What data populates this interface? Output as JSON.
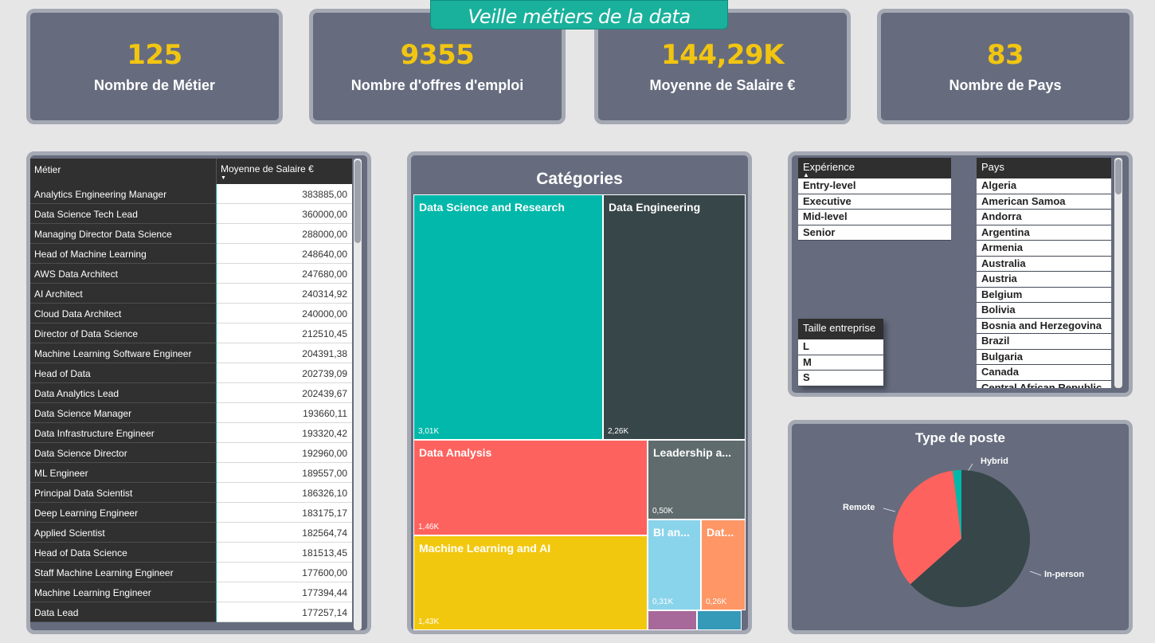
{
  "banner_title": "Veille métiers de la data",
  "kpis": [
    {
      "value": "125",
      "label": "Nombre de Métier"
    },
    {
      "value": "9355",
      "label": "Nombre d'offres d'emploi"
    },
    {
      "value": "144,29K",
      "label": "Moyenne de Salaire €"
    },
    {
      "value": "83",
      "label": "Nombre de Pays"
    }
  ],
  "table": {
    "col1": "Métier",
    "col2": "Moyenne de Salaire €",
    "rows": [
      {
        "name": "Analytics Engineering Manager",
        "value": "383885,00"
      },
      {
        "name": "Data Science Tech Lead",
        "value": "360000,00"
      },
      {
        "name": "Managing Director Data Science",
        "value": "288000,00"
      },
      {
        "name": "Head of Machine Learning",
        "value": "248640,00"
      },
      {
        "name": "AWS Data Architect",
        "value": "247680,00"
      },
      {
        "name": "AI Architect",
        "value": "240314,92"
      },
      {
        "name": "Cloud Data Architect",
        "value": "240000,00"
      },
      {
        "name": "Director of Data Science",
        "value": "212510,45"
      },
      {
        "name": "Machine Learning Software Engineer",
        "value": "204391,38"
      },
      {
        "name": "Head of Data",
        "value": "202739,09"
      },
      {
        "name": "Data Analytics Lead",
        "value": "202439,67"
      },
      {
        "name": "Data Science Manager",
        "value": "193660,11"
      },
      {
        "name": "Data Infrastructure Engineer",
        "value": "193320,42"
      },
      {
        "name": "Data Science Director",
        "value": "192960,00"
      },
      {
        "name": "ML Engineer",
        "value": "189557,00"
      },
      {
        "name": "Principal Data Scientist",
        "value": "186326,10"
      },
      {
        "name": "Deep Learning Engineer",
        "value": "183175,17"
      },
      {
        "name": "Applied Scientist",
        "value": "182564,74"
      },
      {
        "name": "Head of Data Science",
        "value": "181513,45"
      },
      {
        "name": "Staff Machine Learning Engineer",
        "value": "177600,00"
      },
      {
        "name": "Machine Learning Engineer",
        "value": "177394,44"
      },
      {
        "name": "Data Lead",
        "value": "177257,14"
      }
    ]
  },
  "treemap": {
    "title": "Catégories",
    "tiles": [
      {
        "label": "Data Science and Research",
        "value": "3,01K",
        "color": "#01b8aa"
      },
      {
        "label": "Data Engineering",
        "value": "2,26K",
        "color": "#374649"
      },
      {
        "label": "Data Analysis",
        "value": "1,46K",
        "color": "#fd625e"
      },
      {
        "label": "Leadership a...",
        "value": "0,50K",
        "color": "#5f6b6d"
      },
      {
        "label": "Machine Learning and AI",
        "value": "1,43K",
        "color": "#f2c80f"
      },
      {
        "label": "BI an...",
        "value": "0,31K",
        "color": "#8ad4eb"
      },
      {
        "label": "Dat...",
        "value": "0,26K",
        "color": "#fe9666"
      },
      {
        "label": "",
        "value": "",
        "color": "#a66999"
      },
      {
        "label": "",
        "value": "",
        "color": "#3599b8"
      }
    ]
  },
  "slicers": {
    "experience": {
      "title": "Expérience",
      "items": [
        "Entry-level",
        "Executive",
        "Mid-level",
        "Senior"
      ]
    },
    "pays": {
      "title": "Pays",
      "items": [
        "Algeria",
        "American Samoa",
        "Andorra",
        "Argentina",
        "Armenia",
        "Australia",
        "Austria",
        "Belgium",
        "Bolivia",
        "Bosnia and Herzegovina",
        "Brazil",
        "Bulgaria",
        "Canada",
        "Central African Republic"
      ]
    },
    "taille": {
      "title": "Taille entreprise",
      "items": [
        "L",
        "M",
        "S"
      ]
    }
  },
  "pie": {
    "title": "Type de poste",
    "labels": {
      "hybrid": "Hybrid",
      "remote": "Remote",
      "inperson": "In-person"
    },
    "colors": {
      "hybrid": "#01b8aa",
      "remote": "#fd625e",
      "inperson": "#374649"
    }
  }
}
